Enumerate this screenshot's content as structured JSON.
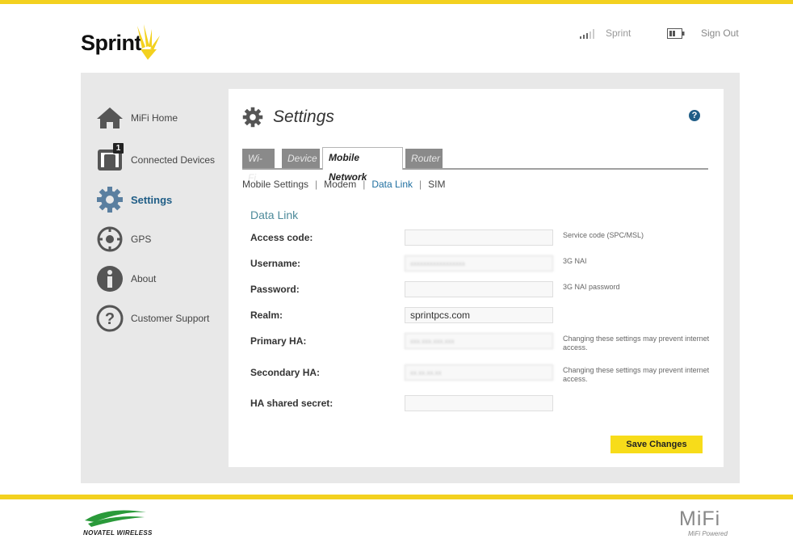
{
  "header": {
    "brand": "Sprint",
    "carrier": "Sprint",
    "sign_out": "Sign Out"
  },
  "sidebar": {
    "items": [
      {
        "label": "MiFi Home"
      },
      {
        "label": "Connected Devices",
        "badge": "1"
      },
      {
        "label": "Settings"
      },
      {
        "label": "GPS"
      },
      {
        "label": "About"
      },
      {
        "label": "Customer Support"
      }
    ]
  },
  "panel": {
    "title": "Settings",
    "help": "?",
    "tabs": [
      "Wi-Fi",
      "Device",
      "Mobile Network",
      "Router"
    ],
    "active_tab": "Mobile Network",
    "subtabs": [
      "Mobile Settings",
      "Modem",
      "Data Link",
      "SIM"
    ],
    "active_subtab": "Data Link",
    "section_title": "Data Link",
    "fields": [
      {
        "label": "Access code:",
        "value": "",
        "hint": "Service code (SPC/MSL)"
      },
      {
        "label": "Username:",
        "value": "xxxxxxxxxxxxxxxxx",
        "hint": "3G NAI"
      },
      {
        "label": "Password:",
        "value": "",
        "hint": "3G NAI password"
      },
      {
        "label": "Realm:",
        "value": "sprintpcs.com",
        "hint": ""
      },
      {
        "label": "Primary HA:",
        "value": "xxx.xxx.xxx.xxx",
        "hint": "Changing these settings may prevent internet access."
      },
      {
        "label": "Secondary HA:",
        "value": "xx.xx.xx.xx",
        "hint": "Changing these settings may prevent internet access."
      },
      {
        "label": "HA shared secret:",
        "value": "",
        "hint": ""
      }
    ],
    "save_label": "Save Changes"
  },
  "footer": {
    "left_brand": "NOVATEL WIRELESS",
    "right_brand": "MiFi",
    "right_sub": "MiFi Powered"
  },
  "colors": {
    "accent_yellow": "#f3d11f",
    "link_blue": "#1f6fa0",
    "section_teal": "#4d8a9a",
    "button_yellow": "#f7dc1a"
  }
}
